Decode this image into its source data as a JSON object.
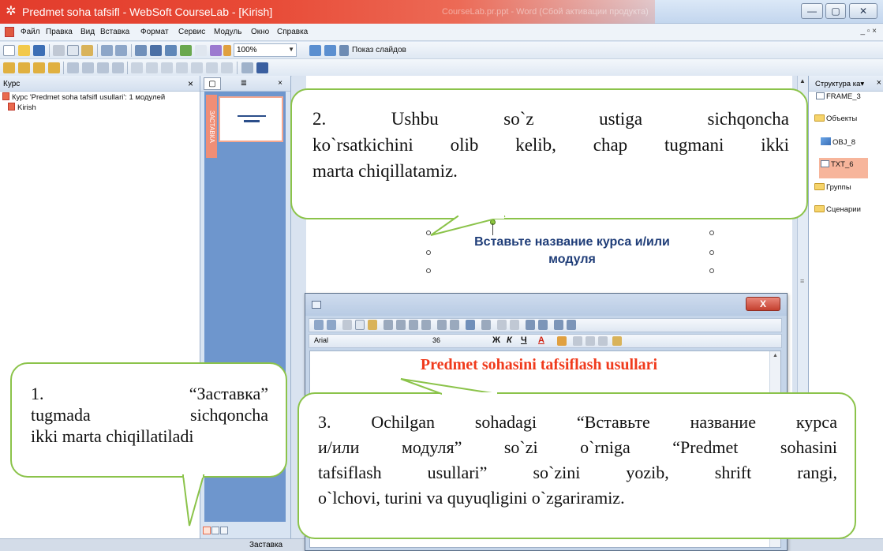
{
  "window": {
    "title": "Predmet soha tafsifl - WebSoft CourseLab - [Kirish]",
    "background_title": "CourseLab.pr.ppt - Word (Сбой активации продукта)",
    "minimize": "—",
    "maximize": "▢",
    "close": "✕"
  },
  "menu": {
    "items": [
      "Файл",
      "Правка",
      "Вид",
      "Вставка",
      "Формат",
      "Сервис",
      "Модуль",
      "Окно",
      "Справка"
    ],
    "right_controls": "_ ▫ ×"
  },
  "toolbar": {
    "zoom_value": "100%",
    "slideshow_label": "Показ слайдов"
  },
  "course_panel": {
    "title": "Курс",
    "close": "×",
    "tree": [
      "Курс 'Predmet soha tafsifl usullari': 1 модулей",
      "Kirish"
    ]
  },
  "thumb_panel": {
    "close": "×",
    "slide_label": "ЗАСТАВКА"
  },
  "canvas": {
    "title_line1": "Вставьте название курса и/или",
    "title_line2": "модуля"
  },
  "structure_panel": {
    "title": "Структура ка▾",
    "close": "×",
    "items": {
      "frame": "FRAME_3",
      "objects": "Объекты",
      "obj": "OBJ_8",
      "txt": "TXT_6",
      "groups": "Группы",
      "scenarios": "Сценарии"
    }
  },
  "text_editor": {
    "close": "X",
    "font": "Arial",
    "size": "36",
    "bold": "Ж",
    "italic": "К",
    "underline": "Ч",
    "text": "Predmet sohasini tafsiflash usullari"
  },
  "callouts": {
    "c1": {
      "line1": "1. “Заставка”",
      "line2": "tugmada sichqoncha",
      "line3": "ikki marta chiqillatiladi"
    },
    "c2": {
      "line1": "2. Ushbu so`z ustiga sichqoncha",
      "line2": "ko`rsatkichini olib kelib, chap tugmani ikki",
      "line3": "marta chiqillatamiz."
    },
    "c3": {
      "line1": "3. Ochilgan sohadagi “Вставьте название курса",
      "line2": "и/или модуля” so`zi o`rniga “Predmet sohasini",
      "line3": "tafsiflash usullari” so`zini yozib, shrift rangi,",
      "line4": "o`lchovi, turini va quyuqligini o`zgariramiz."
    }
  },
  "statusbar": {
    "text": "Заставка"
  },
  "colors": {
    "title_red": "#e23c2c",
    "callout_border": "#8bc34a",
    "dialog_text": "#f03a1c",
    "canvas_title": "#1f3d78",
    "thumb_strip": "#6e96cd"
  }
}
